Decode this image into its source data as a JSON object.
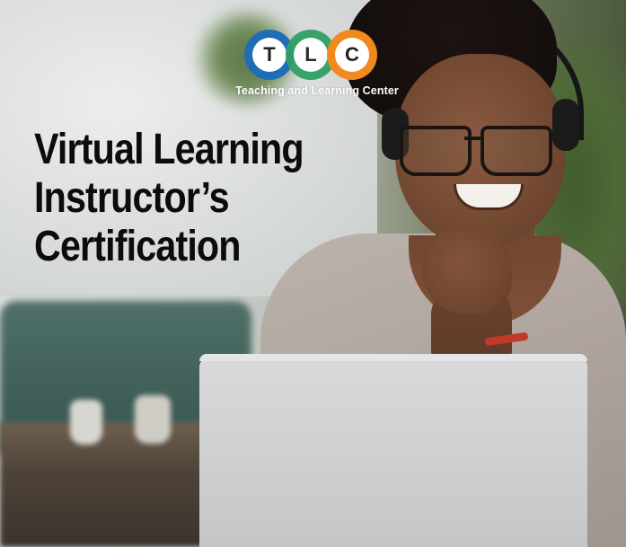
{
  "logo": {
    "letters": [
      "T",
      "L",
      "C"
    ],
    "colors": [
      "#1f6db5",
      "#2fa067",
      "#f08a1e"
    ],
    "tagline": "Teaching and Learning Center"
  },
  "headline": {
    "lines": [
      "Virtual Learning",
      "Instructor’s",
      "Certification"
    ]
  },
  "photo": {
    "subject": "woman-with-headset-at-laptop"
  }
}
